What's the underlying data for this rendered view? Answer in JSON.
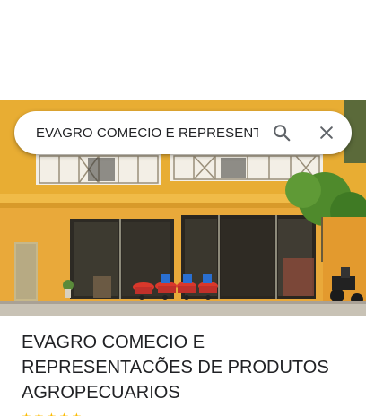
{
  "search": {
    "query": "EVAGRO COMECIO E REPRESENTAC"
  },
  "icons": {
    "search": "search-icon",
    "close": "close-icon",
    "star": "star-icon"
  },
  "place": {
    "title": "EVAGRO COMECIO E REPRESENTACÕES DE PRODUTOS AGROPECUARIOS",
    "rating_stars": 5
  },
  "colors": {
    "building_wall": "#e8ad33",
    "star": "#fbbc04",
    "search_icon": "#5f6368"
  }
}
